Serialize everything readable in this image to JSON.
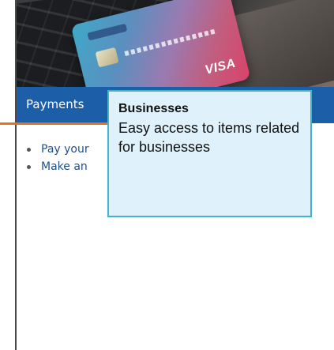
{
  "hero": {
    "card_brand": "VISA"
  },
  "nav": {
    "label": "Payments"
  },
  "content": {
    "items": [
      {
        "label": "Pay your"
      },
      {
        "label": "Make an"
      }
    ]
  },
  "tooltip": {
    "title": "Businesses",
    "body": "Easy access to items related for businesses"
  },
  "colors": {
    "nav_blue": "#1d5ea8",
    "accent_orange": "#e4731d",
    "tooltip_bg": "#dff2fb",
    "tooltip_border": "#45b1d3",
    "link_blue": "#1f4e8c"
  }
}
